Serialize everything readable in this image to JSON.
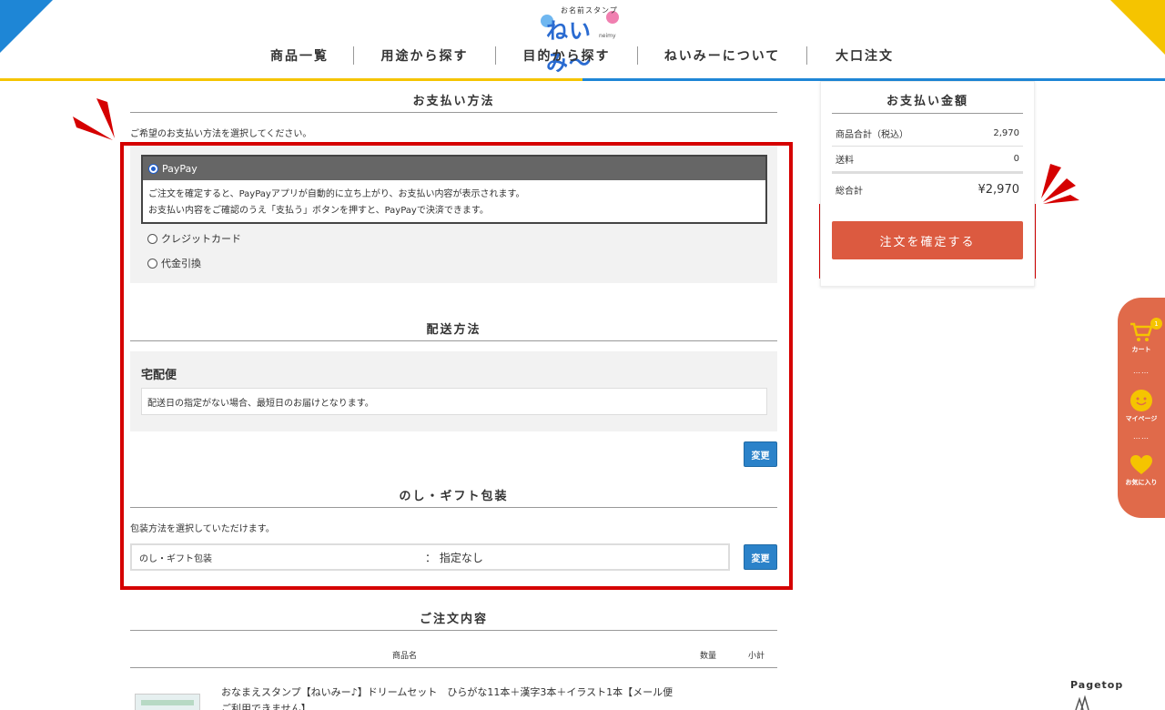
{
  "header": {
    "logo_sub": "お名前スタンプ",
    "logo_main": "ねいみ〜",
    "logo_roman": "neimy",
    "nav": [
      "商品一覧",
      "用途から探す",
      "目的から探す",
      "ねいみーについて",
      "大口注文"
    ]
  },
  "payment": {
    "title": "お支払い方法",
    "note": "ご希望のお支払い方法を選択してください。",
    "selected_label": "PayPay",
    "selected_desc_1": "ご注文を確定すると、PayPayアプリが自動的に立ち上がり、お支払い内容が表示されます。",
    "selected_desc_2": "お支払い内容をご確認のうえ「支払う」ボタンを押すと、PayPayで決済できます。",
    "options": [
      "クレジットカード",
      "代金引換"
    ]
  },
  "shipping": {
    "title": "配送方法",
    "method": "宅配便",
    "note": "配送日の指定がない場合、最短日のお届けとなります。",
    "change_label": "変更"
  },
  "gift": {
    "title": "のし・ギフト包装",
    "note": "包装方法を選択していただけます。",
    "row_label": "のし・ギフト包装",
    "row_value": "：  指定なし",
    "change_label": "変更"
  },
  "order": {
    "title": "ご注文内容",
    "col_name": "商品名",
    "col_qty": "数量",
    "col_subtotal": "小計",
    "product_name": "おなまえスタンプ【ねいみー♪】ドリームセット　ひらがな11本＋漢字3本＋イラスト1本【メール便ご利用できません】"
  },
  "summary": {
    "title": "お支払い金額",
    "rows": [
      {
        "label": "商品合計（税込）",
        "value": "2,970"
      },
      {
        "label": "送料",
        "value": "0"
      }
    ],
    "total_label": "総合計",
    "total_value": "¥2,970",
    "confirm_label": "注文を確定する"
  },
  "side_menu": {
    "cart_label": "カート",
    "cart_count": "1",
    "mypage_label": "マイページ",
    "favorite_label": "お気に入り",
    "dots": "……"
  },
  "pagetop": "Pagetop",
  "colors": {
    "highlight_red": "#d50000",
    "confirm_button": "#dc5a40",
    "change_button": "#2b82c9",
    "header_blue": "#1e86d6",
    "header_yellow": "#f5c400",
    "side_menu": "#e06a4a"
  }
}
